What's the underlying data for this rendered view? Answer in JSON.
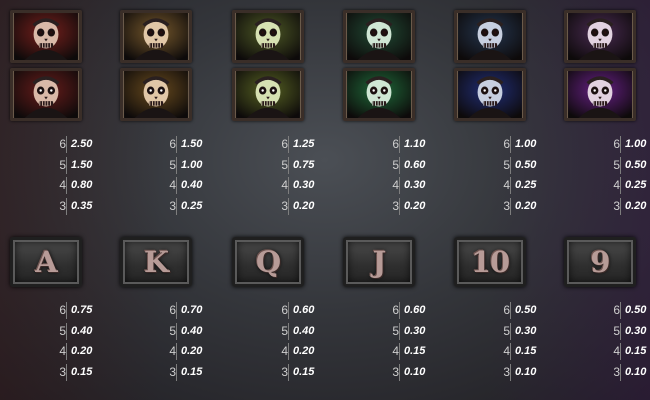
{
  "premium_symbols": [
    {
      "id": "zombie-red",
      "top_color": "#7a1e1a",
      "bottom_color": "#6a1a18",
      "skin": "#d9b9a8",
      "pays": [
        {
          "count": "6",
          "value": "2.50"
        },
        {
          "count": "5",
          "value": "1.50"
        },
        {
          "count": "4",
          "value": "0.80"
        },
        {
          "count": "3",
          "value": "0.35"
        }
      ]
    },
    {
      "id": "zombie-amber",
      "top_color": "#7a5a2a",
      "bottom_color": "#6a4a1a",
      "skin": "#e1c7a7",
      "pays": [
        {
          "count": "6",
          "value": "1.50"
        },
        {
          "count": "5",
          "value": "1.00"
        },
        {
          "count": "4",
          "value": "0.40"
        },
        {
          "count": "3",
          "value": "0.25"
        }
      ]
    },
    {
      "id": "zombie-olive",
      "top_color": "#4e5a22",
      "bottom_color": "#56621e",
      "skin": "#d6e0b2",
      "pays": [
        {
          "count": "6",
          "value": "1.25"
        },
        {
          "count": "5",
          "value": "0.75"
        },
        {
          "count": "4",
          "value": "0.30"
        },
        {
          "count": "3",
          "value": "0.20"
        }
      ]
    },
    {
      "id": "zombie-green",
      "top_color": "#1e4a32",
      "bottom_color": "#1b6a36",
      "skin": "#cfe6d4",
      "pays": [
        {
          "count": "6",
          "value": "1.10"
        },
        {
          "count": "5",
          "value": "0.60"
        },
        {
          "count": "4",
          "value": "0.30"
        },
        {
          "count": "3",
          "value": "0.20"
        }
      ]
    },
    {
      "id": "zombie-blue",
      "top_color": "#22344e",
      "bottom_color": "#1e2c7a",
      "skin": "#c7cfe0",
      "pays": [
        {
          "count": "6",
          "value": "1.00"
        },
        {
          "count": "5",
          "value": "0.50"
        },
        {
          "count": "4",
          "value": "0.25"
        },
        {
          "count": "3",
          "value": "0.20"
        }
      ]
    },
    {
      "id": "zombie-purple",
      "top_color": "#4a2a52",
      "bottom_color": "#6a1e8a",
      "skin": "#e2d2e0",
      "pays": [
        {
          "count": "6",
          "value": "1.00"
        },
        {
          "count": "5",
          "value": "0.50"
        },
        {
          "count": "4",
          "value": "0.25"
        },
        {
          "count": "3",
          "value": "0.20"
        }
      ]
    }
  ],
  "card_symbols": [
    {
      "glyph": "A",
      "pays": [
        {
          "count": "6",
          "value": "0.75"
        },
        {
          "count": "5",
          "value": "0.40"
        },
        {
          "count": "4",
          "value": "0.20"
        },
        {
          "count": "3",
          "value": "0.15"
        }
      ]
    },
    {
      "glyph": "K",
      "pays": [
        {
          "count": "6",
          "value": "0.70"
        },
        {
          "count": "5",
          "value": "0.40"
        },
        {
          "count": "4",
          "value": "0.20"
        },
        {
          "count": "3",
          "value": "0.15"
        }
      ]
    },
    {
      "glyph": "Q",
      "pays": [
        {
          "count": "6",
          "value": "0.60"
        },
        {
          "count": "5",
          "value": "0.40"
        },
        {
          "count": "4",
          "value": "0.20"
        },
        {
          "count": "3",
          "value": "0.15"
        }
      ]
    },
    {
      "glyph": "J",
      "pays": [
        {
          "count": "6",
          "value": "0.60"
        },
        {
          "count": "5",
          "value": "0.30"
        },
        {
          "count": "4",
          "value": "0.15"
        },
        {
          "count": "3",
          "value": "0.10"
        }
      ]
    },
    {
      "glyph": "10",
      "pays": [
        {
          "count": "6",
          "value": "0.50"
        },
        {
          "count": "5",
          "value": "0.30"
        },
        {
          "count": "4",
          "value": "0.15"
        },
        {
          "count": "3",
          "value": "0.10"
        }
      ]
    },
    {
      "glyph": "9",
      "pays": [
        {
          "count": "6",
          "value": "0.50"
        },
        {
          "count": "5",
          "value": "0.30"
        },
        {
          "count": "4",
          "value": "0.15"
        },
        {
          "count": "3",
          "value": "0.10"
        }
      ]
    }
  ]
}
